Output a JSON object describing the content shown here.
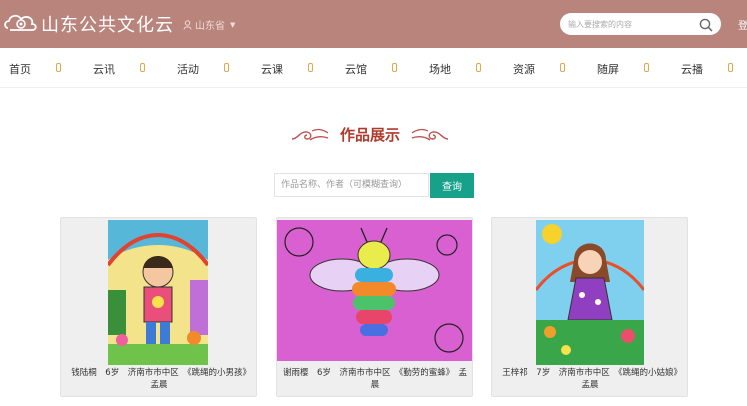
{
  "header": {
    "site_title": "山东公共文化云",
    "region": "山东省",
    "search_placeholder": "输入要搜索的内容",
    "login": "登"
  },
  "nav": {
    "items": [
      "首页",
      "云讯",
      "活动",
      "云课",
      "云馆",
      "场地",
      "资源",
      "随屏",
      "云播"
    ]
  },
  "section": {
    "title": "作品展示",
    "query_placeholder": "作品名称、作者（可模糊查询）",
    "query_button": "查询"
  },
  "works": [
    {
      "caption": "钱陆桐　6岁　济南市市中区　《跳绳的小男孩》　孟晨"
    },
    {
      "caption": "谢雨樱　6岁　济南市市中区　《勤劳的蜜蜂》　孟晨"
    },
    {
      "caption": "王梓祁　7岁　济南市市中区　《跳绳的小姑娘》　孟晨"
    }
  ],
  "colors": {
    "header_bg": "#b8847c",
    "accent_title": "#b03a2e",
    "query_button": "#17a08a",
    "nav_separator": "#e0a94a"
  }
}
